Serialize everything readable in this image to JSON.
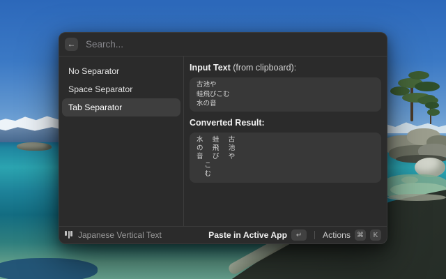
{
  "colors": {
    "window_bg": "#2b2b2b",
    "block_bg": "#383838",
    "selected_item_bg": "#3e3e3e",
    "divider": "#3c3c3c"
  },
  "search": {
    "placeholder": "Search...",
    "back_glyph": "←"
  },
  "sidebar": {
    "selected_index": 2,
    "items": [
      {
        "label": "No Separator"
      },
      {
        "label": "Space Separator"
      },
      {
        "label": "Tab Separator"
      }
    ]
  },
  "detail": {
    "input_heading_bold": "Input Text",
    "input_heading_rest": " (from clipboard):",
    "input_text": "古池や\n蛙飛びこむ\n水の音",
    "result_heading": "Converted Result:",
    "converted_text": "水\t蛙\t古\nの\t飛\t池\n音\tび\tや\n\tこ\n\tむ"
  },
  "footer": {
    "extension_name": "Japanese Vertical Text",
    "primary_action": "Paste in Active App",
    "primary_key": "↵",
    "actions_label": "Actions",
    "actions_keys": [
      "⌘",
      "K"
    ]
  }
}
